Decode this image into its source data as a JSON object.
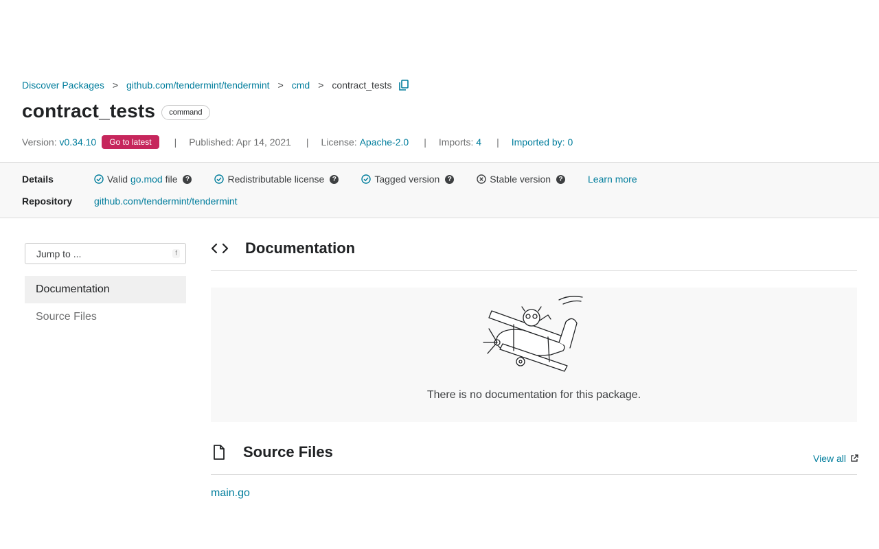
{
  "breadcrumb": {
    "items": [
      "Discover Packages",
      "github.com/tendermint/tendermint",
      "cmd"
    ],
    "current": "contract_tests",
    "separator": ">"
  },
  "header": {
    "title": "contract_tests",
    "chip": "command"
  },
  "meta": {
    "version_label": "Version:",
    "version_value": "v0.34.10",
    "go_latest": "Go to latest",
    "divider": "|",
    "published": "Published: Apr 14, 2021",
    "license_label": "License:",
    "license_value": "Apache-2.0",
    "imports_label": "Imports:",
    "imports_value": "4",
    "imported_by": "Imported by: 0"
  },
  "details": {
    "label": "Details",
    "valid_prefix": "Valid",
    "valid_link": "go.mod",
    "valid_suffix": "file",
    "redistributable": "Redistributable license",
    "tagged": "Tagged version",
    "stable": "Stable version",
    "learn_more": "Learn more",
    "repo_label": "Repository",
    "repo_value": "github.com/tendermint/tendermint",
    "qmark": "?"
  },
  "sidebar": {
    "jump_placeholder": "Jump to ...",
    "jump_key": "f",
    "items": [
      "Documentation",
      "Source Files"
    ]
  },
  "documentation": {
    "title": "Documentation",
    "empty_message": "There is no documentation for this package."
  },
  "source_files": {
    "title": "Source Files",
    "view_all": "View all",
    "files": [
      "main.go"
    ]
  },
  "colors": {
    "link": "#007d9c",
    "pill": "#c6265c",
    "band": "#f8f8f8"
  }
}
